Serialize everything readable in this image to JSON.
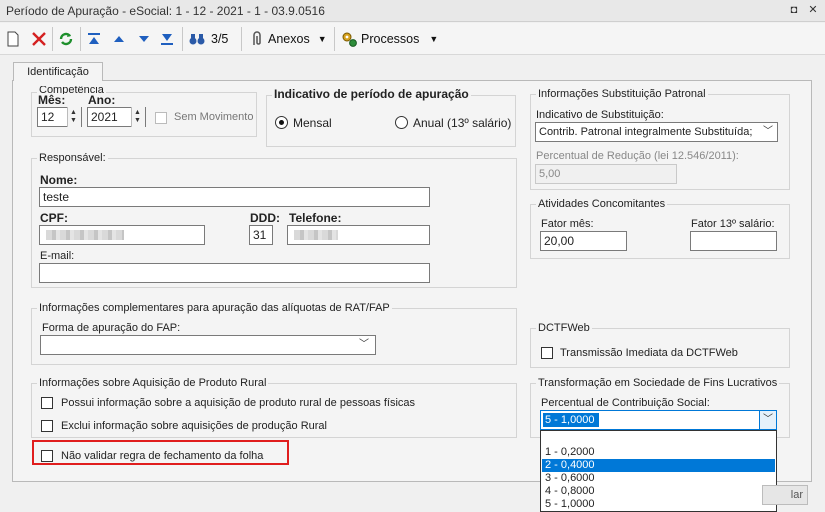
{
  "window": {
    "title": "Período de Apuração - eSocial: 1 - 12 - 2021 - 1 - 03.9.0516",
    "restore_glyph": "◘",
    "close_glyph": "✕"
  },
  "toolbar": {
    "record_counter": "3/5",
    "anexos_label": "Anexos",
    "processos_label": "Processos"
  },
  "tab": {
    "label": "Identificação"
  },
  "competencia": {
    "group_label": "Competência",
    "mes_label": "Mês:",
    "mes_value": "12",
    "ano_label": "Ano:",
    "ano_value": "2021",
    "sem_movimento_label": "Sem Movimento"
  },
  "indicativo": {
    "group_label": "Indicativo de período de apuração",
    "mensal_label": "Mensal",
    "anual_label": "Anual (13º salário)",
    "selected": "Mensal"
  },
  "responsavel": {
    "group_label": "Responsável:",
    "nome_label": "Nome:",
    "nome_value": "teste",
    "cpf_label": "CPF:",
    "ddd_label": "DDD:",
    "ddd_value": "31",
    "telefone_label": "Telefone:",
    "email_label": "E-mail:",
    "email_value": ""
  },
  "substituicao": {
    "group_label": "Informações Substituição Patronal",
    "indicativo_label": "Indicativo de Substituição:",
    "indicativo_value": "Contrib. Patronal integralmente Substituída;",
    "percentual_label": "Percentual de Redução  (lei 12.546/2011):",
    "percentual_value": "5,00"
  },
  "concomitantes": {
    "group_label": "Atividades Concomitantes",
    "fator_mes_label": "Fator mês:",
    "fator_mes_value": "20,00",
    "fator_13_label": "Fator 13º salário:",
    "fator_13_value": ""
  },
  "rat_fap": {
    "group_label": "Informações complementares para apuração das alíquotas de RAT/FAP",
    "forma_label": "Forma de apuração do FAP:",
    "forma_value": ""
  },
  "dctfweb": {
    "group_label": "DCTFWeb",
    "transmissao_label": "Transmissão Imediata da DCTFWeb"
  },
  "produto_rural": {
    "group_label": "Informações sobre Aquisição de Produto Rural",
    "possui_label": "Possui informação sobre a aquisição de produto rural de pessoas físicas",
    "exclui_label": "Exclui informação sobre aquisições de produção Rural"
  },
  "nao_validar": {
    "label": "Não validar regra de fechamento da folha"
  },
  "transformacao": {
    "group_label": "Transformação em Sociedade de Fins Lucrativos",
    "percentual_label": "Percentual de Contribuição Social:",
    "selected_value": "5 - 1,0000",
    "options": [
      "",
      "1 - 0,2000",
      "2 - 0,4000",
      "3 - 0,6000",
      "4 - 0,8000",
      "5 - 1,0000"
    ],
    "highlighted_option": "2 - 0,4000"
  },
  "footer": {
    "partial_button_label": "lar"
  },
  "colors": {
    "highlight": "#0078d7",
    "annotation_red": "#e01d1d",
    "focus_border": "#0078d7"
  }
}
